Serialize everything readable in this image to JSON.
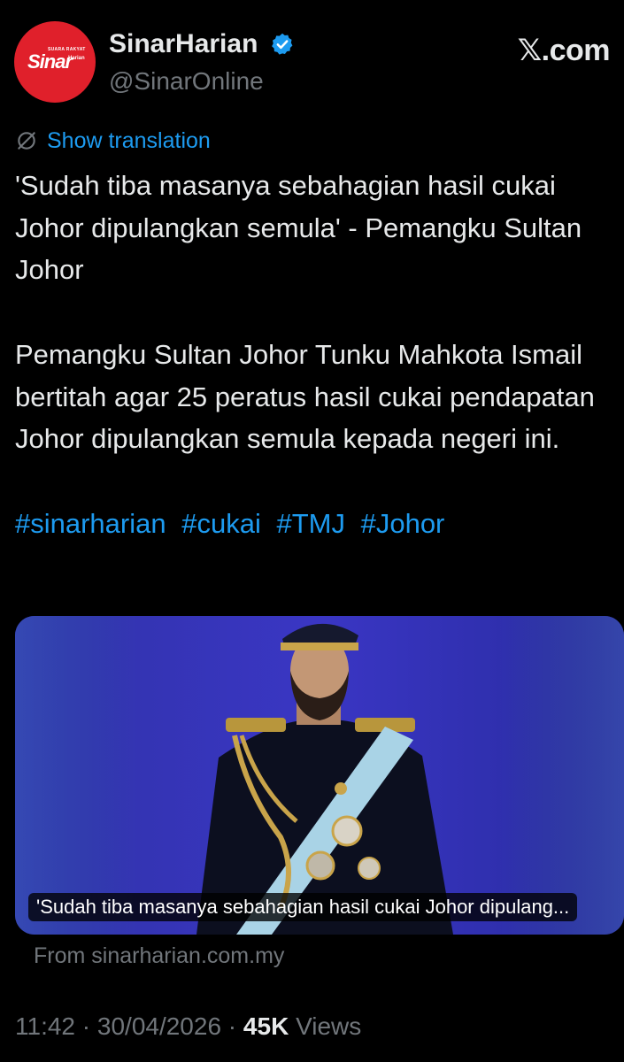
{
  "author": {
    "display_name": "SinarHarian",
    "handle": "@SinarOnline",
    "verified": true,
    "avatar": {
      "brand_word": "Sinar",
      "tagline": "SUARA RAKYAT",
      "sub_word": "Harian",
      "background_color": "#e0202b"
    }
  },
  "site_mark": {
    "glyph": "𝕏",
    "suffix": ".com"
  },
  "translation": {
    "label": "Show translation",
    "icon": "globe-slash-icon"
  },
  "tweet": {
    "headline": "'Sudah tiba masanya sebahagian hasil cukai Johor dipulangkan semula' - Pemangku Sultan Johor",
    "body": "Pemangku Sultan Johor Tunku Mahkota Ismail bertitah agar 25 peratus hasil cukai pendapatan Johor dipulangkan semula kepada negeri ini.",
    "hashtags": [
      "#sinarharian",
      "#cukai",
      "#TMJ",
      "#Johor"
    ]
  },
  "card": {
    "caption": "'Sudah tiba masanya sebahagian hasil cukai Johor dipulang...",
    "source": "From sinarharian.com.my"
  },
  "meta": {
    "time": "11:42",
    "separator": " · ",
    "date": "30/04/2026",
    "views_count": "45K",
    "views_label": " Views"
  },
  "colors": {
    "background": "#000000",
    "text": "#e7e9ea",
    "secondary": "#71767b",
    "link": "#1d9bf0"
  }
}
